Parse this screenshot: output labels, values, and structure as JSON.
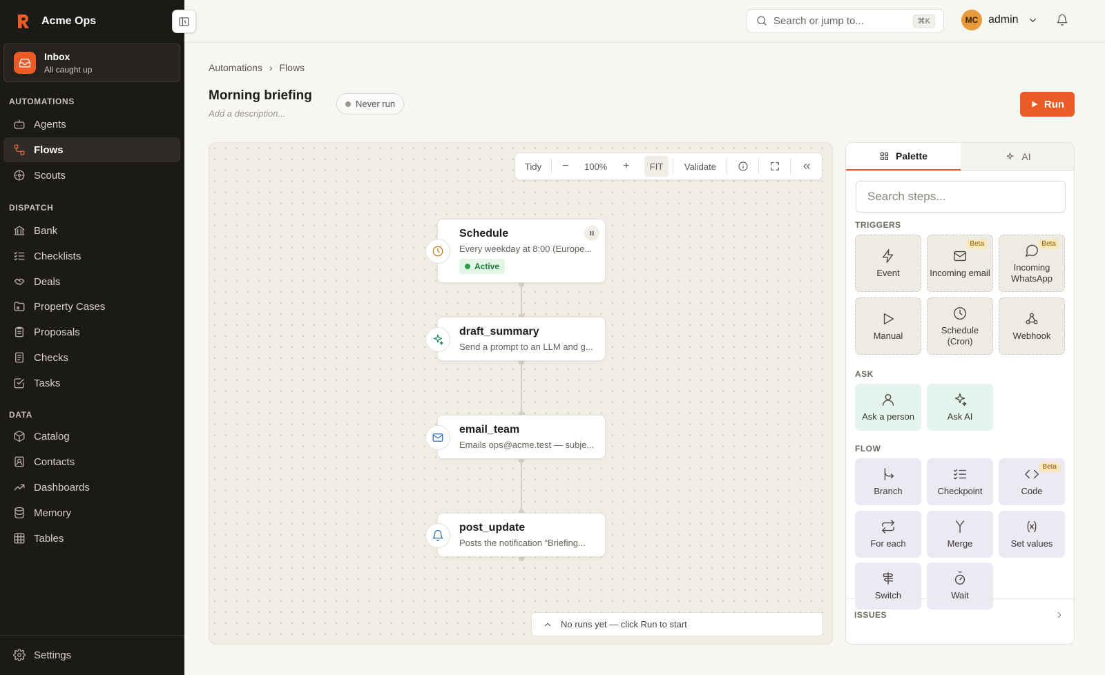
{
  "app": {
    "name": "Acme Ops"
  },
  "inbox": {
    "title": "Inbox",
    "subtitle": "All caught up"
  },
  "sidebar": {
    "sections": [
      {
        "title": "AUTOMATIONS",
        "items": [
          "Agents",
          "Flows",
          "Scouts"
        ]
      },
      {
        "title": "DISPATCH",
        "items": [
          "Bank",
          "Checklists",
          "Deals",
          "Property Cases",
          "Proposals",
          "Checks",
          "Tasks"
        ]
      },
      {
        "title": "DATA",
        "items": [
          "Catalog",
          "Contacts",
          "Dashboards",
          "Memory",
          "Tables"
        ]
      }
    ],
    "active_item": "Flows",
    "footer": {
      "settings": "Settings"
    }
  },
  "topbar": {
    "search": {
      "placeholder": "Search or jump to...",
      "shortcut": "⌘K"
    },
    "user": {
      "initials": "MC",
      "name": "admin"
    }
  },
  "breadcrumb": {
    "parent": "Automations",
    "separator": "›",
    "current": "Flows"
  },
  "flow": {
    "title": "Morning briefing",
    "description_placeholder": "Add a description...",
    "status": "Never run",
    "run_label": "Run"
  },
  "toolbar": {
    "tidy": "Tidy",
    "minus": "−",
    "zoom": "100%",
    "plus": "+",
    "fit": "FIT",
    "validate": "Validate"
  },
  "nodes": [
    {
      "title": "Schedule",
      "subtitle": "Every weekday at 8:00 (Europe...",
      "badge": "Active",
      "icon": "clock-icon"
    },
    {
      "title": "draft_summary",
      "subtitle": "Send a prompt to an LLM and g...",
      "icon": "sparkle-icon"
    },
    {
      "title": "email_team",
      "subtitle": "Emails ops@acme.test — subje...",
      "icon": "mail-icon"
    },
    {
      "title": "post_update",
      "subtitle": "Posts the notification “Briefing...",
      "icon": "bell-icon"
    }
  ],
  "runs_bar": {
    "text": "No runs yet — click Run to start"
  },
  "panel": {
    "tabs": {
      "palette": "Palette",
      "ai": "AI"
    },
    "search_placeholder": "Search steps...",
    "sections": {
      "triggers": "TRIGGERS",
      "ask": "ASK",
      "flow": "FLOW"
    },
    "triggers": [
      {
        "label": "Event",
        "beta": ""
      },
      {
        "label": "Incoming email",
        "beta": "Beta"
      },
      {
        "label": "Incoming WhatsApp",
        "beta": "Beta"
      },
      {
        "label": "Manual",
        "beta": ""
      },
      {
        "label": "Schedule (Cron)",
        "beta": ""
      },
      {
        "label": "Webhook",
        "beta": ""
      }
    ],
    "ask": [
      {
        "label": "Ask a person"
      },
      {
        "label": "Ask AI"
      }
    ],
    "flow_steps": [
      {
        "label": "Branch",
        "beta": ""
      },
      {
        "label": "Checkpoint",
        "beta": ""
      },
      {
        "label": "Code",
        "beta": "Beta"
      },
      {
        "label": "For each",
        "beta": ""
      },
      {
        "label": "Merge",
        "beta": ""
      },
      {
        "label": "Set values",
        "beta": ""
      },
      {
        "label": "Switch",
        "beta": ""
      },
      {
        "label": "Wait",
        "beta": ""
      }
    ],
    "issues": "ISSUES"
  },
  "colors": {
    "accent": "#ec5a26",
    "sidebar_bg": "#1c1a17",
    "active_green": "#27a047"
  }
}
